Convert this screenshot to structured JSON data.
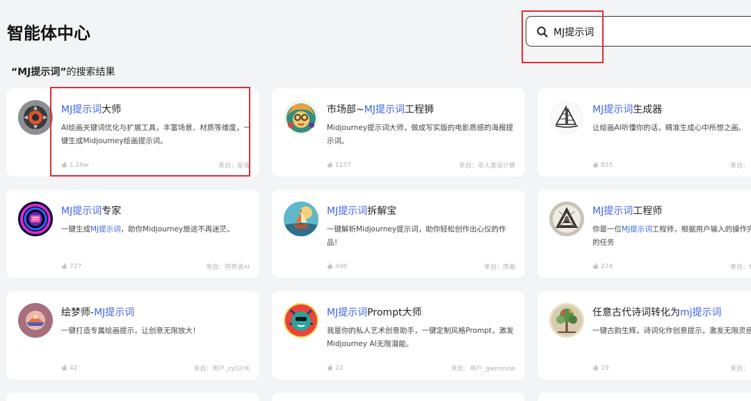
{
  "page": {
    "title": "智能体中心"
  },
  "search": {
    "value": "MJ提示词"
  },
  "results_label": {
    "query": "“MJ提示词”",
    "suffix": "的搜索结果"
  },
  "cards": [
    {
      "kw_before": "",
      "kw": "MJ提示词",
      "kw_after": "大师",
      "desc_parts": [
        "AI绘画关键词优化与扩展工具，丰富场景、材质等维度，一键生成Midjourney绘画提示词。",
        "",
        ""
      ],
      "uses": "1.26w",
      "source": "来自：星海",
      "avatar": "dark-gear"
    },
    {
      "kw_before": "市场部~",
      "kw": "MJ提示词",
      "kw_after": "工程狮",
      "desc_parts": [
        "Midjourney提示词大师，做成写实版的电影质感的海报提示词。",
        "",
        ""
      ],
      "uses": "1157",
      "source": "来自：非人类设计狮",
      "avatar": "colorful-lion"
    },
    {
      "kw_before": "",
      "kw": "MJ提示词",
      "kw_after": "生成器",
      "desc_parts": [
        "让绘画AI听懂你的话，精准生成心中所想之画。",
        "",
        ""
      ],
      "uses": "855",
      "source": "来自：",
      "avatar": "sailboat"
    },
    {
      "kw_before": "",
      "kw": "MJ提示词",
      "kw_after": "专家",
      "desc_parts": [
        "一键生成",
        "MJ提示词",
        "，助你Midjourney旅途不再迷茫。"
      ],
      "uses": "727",
      "source": "来自：阿奇说AI",
      "avatar": "neon-ring"
    },
    {
      "kw_before": "",
      "kw": "MJ提示词",
      "kw_after": "拆解宝",
      "desc_parts": [
        "一键解析Midjourney提示词，助你轻松创作出心仪的作品！",
        "",
        ""
      ],
      "uses": "498",
      "source": "来自：序曲",
      "avatar": "fantasy-ship"
    },
    {
      "kw_before": "",
      "kw": "MJ提示词",
      "kw_after": "工程师",
      "desc_parts": [
        "你是一位",
        "MJ提示词",
        "工程师，根据用户输入的操作完成对应的任务"
      ],
      "uses": "274",
      "source": "来自：M",
      "avatar": "geometric-emblem"
    },
    {
      "kw_before": "绘梦师-",
      "kw": "MJ提示词",
      "kw_after": "",
      "desc_parts": [
        "一键打造专属绘画提示，让创意无限放大！",
        "",
        ""
      ],
      "uses": "42",
      "source": "来自：用户_zyGIYK",
      "avatar": "dream-landscape"
    },
    {
      "kw_before": "",
      "kw": "MJ提示词",
      "kw_after": "Prompt大师",
      "desc_parts": [
        "我是你的私人艺术创意助手，一键定制风格Prompt，激发Midjourney AI无限潜能。",
        "",
        ""
      ],
      "uses": "22",
      "source": "来自：用户_gwmmzw",
      "avatar": "pop-art-face"
    },
    {
      "kw_before": "任意古代诗词转化为",
      "kw": "mj提示词",
      "kw_after": "",
      "desc_parts": [
        "一键古韵生辉，诗词化作创意提示，激发无限灵感",
        "",
        ""
      ],
      "uses": "19",
      "source": "来自：",
      "avatar": "ancient-tree"
    }
  ],
  "colors": {
    "keyword": "#3c63e8",
    "highlight": "#e5292f",
    "background": "#f3f4f6"
  },
  "icons": {
    "search": "search-icon",
    "uses": "fire-icon"
  }
}
